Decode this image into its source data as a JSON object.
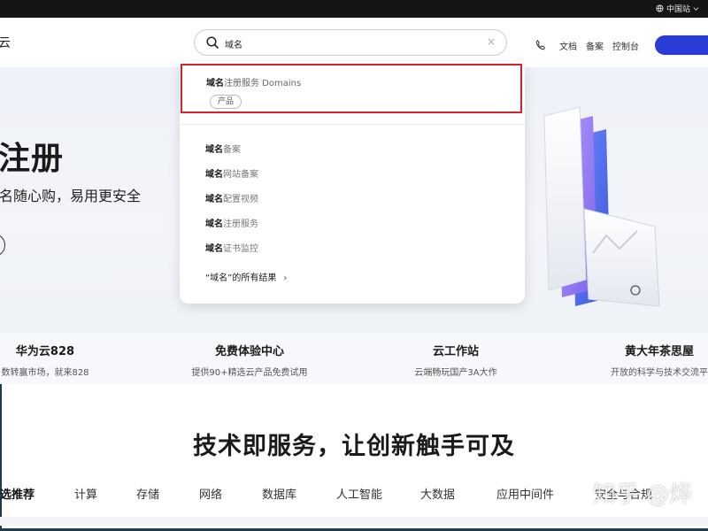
{
  "top_bar": {
    "region_label": "中国站"
  },
  "header": {
    "logo_fragment": "云",
    "links": [
      "文档",
      "备案",
      "控制台"
    ]
  },
  "search": {
    "query": "域名",
    "clear_symbol": "×"
  },
  "dropdown": {
    "top_result": {
      "highlight": "域名",
      "rest": "注册服务 Domains",
      "chip": "产品"
    },
    "suggestions": [
      {
        "highlight": "域名",
        "rest": "备案"
      },
      {
        "highlight": "域名",
        "rest": "网站备案"
      },
      {
        "highlight": "域名",
        "rest": "配置视频"
      },
      {
        "highlight": "域名",
        "rest": "注册服务"
      },
      {
        "highlight": "域名",
        "rest": "证书监控"
      }
    ],
    "all_results": "“域名”的所有结果",
    "all_results_chevron": "›"
  },
  "hero": {
    "title": "注册",
    "subtitle": "名随心购，易用更安全"
  },
  "promos": [
    {
      "title": "华为云828",
      "desc": "数转赢市场，就来828"
    },
    {
      "title": "免费体验中心",
      "desc": "提供90+精选云产品免费试用"
    },
    {
      "title": "云工作站",
      "desc": "云端畅玩国产3A大作"
    },
    {
      "title": "黄大年茶思屋",
      "desc": "开放的科学与技术交流平"
    }
  ],
  "section": {
    "title": "技术即服务，让创新触手可及",
    "tabs": [
      "选推荐",
      "计算",
      "存储",
      "网络",
      "数据库",
      "人工智能",
      "大数据",
      "应用中间件",
      "安全与合规"
    ]
  },
  "watermark": "知乎 @烨",
  "colors": {
    "accent": "#2a3bd6",
    "highlight_border": "#d2232a"
  }
}
